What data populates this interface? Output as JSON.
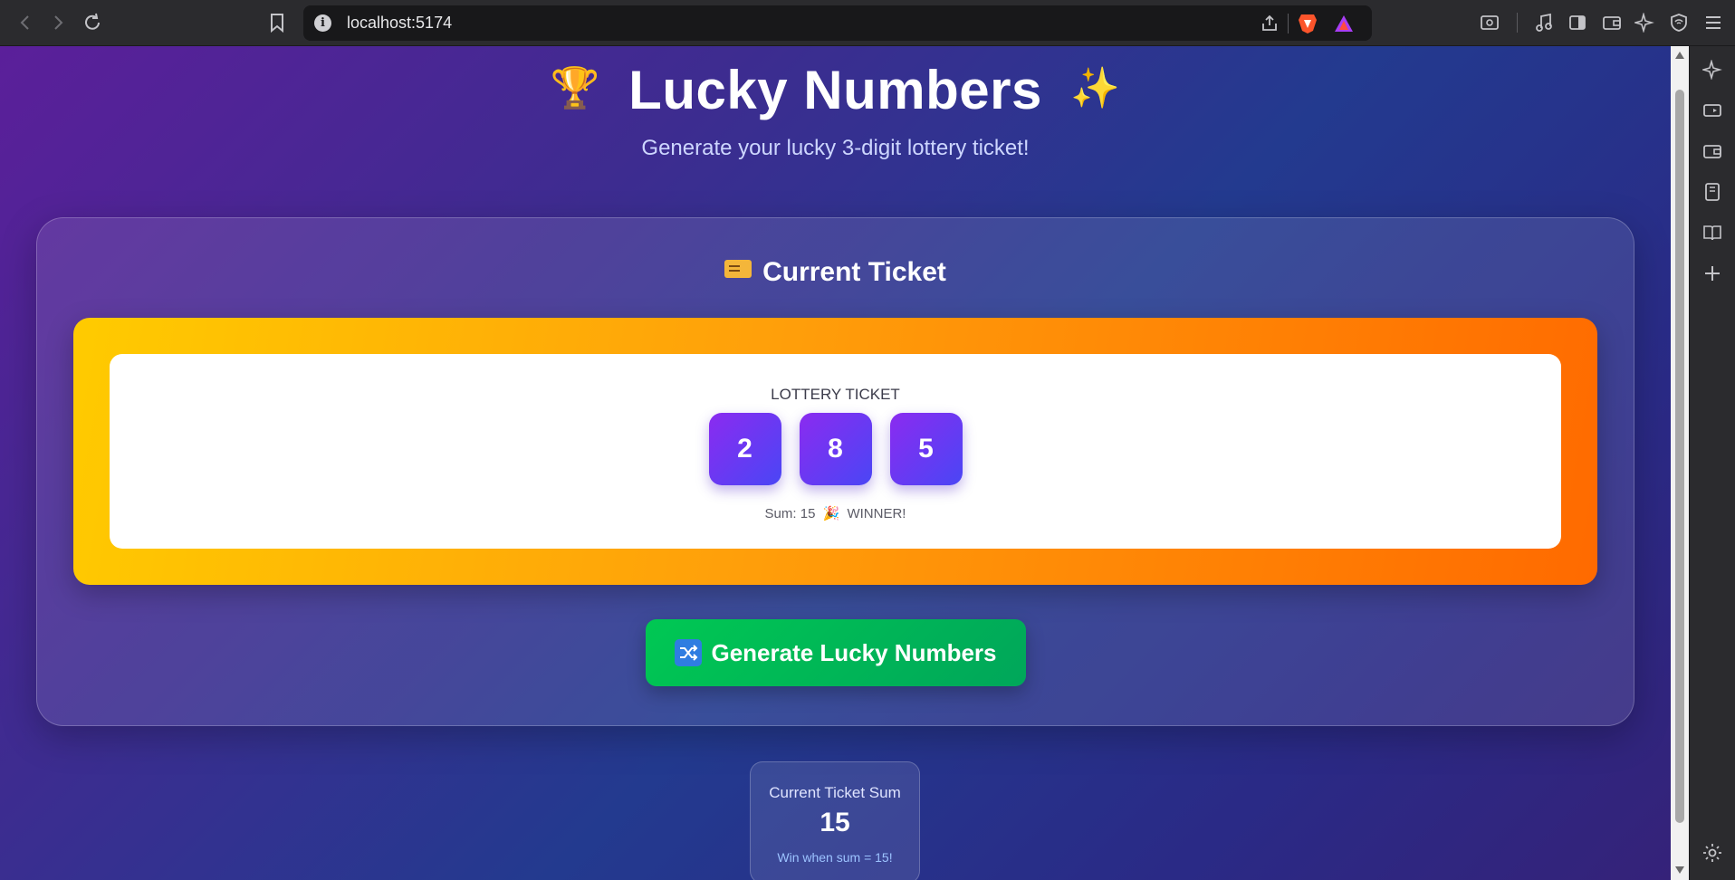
{
  "browser": {
    "url": "localhost:5174",
    "nav_icons": [
      "back-arrow-icon",
      "forward-arrow-icon",
      "reload-icon",
      "bookmark-icon"
    ],
    "toolbar_icons": [
      "page-search-icon",
      "music-icon",
      "sidebar-icon",
      "wallet-icon",
      "leo-ai-icon",
      "vpn-shield-icon",
      "menu-icon"
    ],
    "sidebar_icons": [
      "leo-ai-icon",
      "video-icon",
      "wallet-icon",
      "reading-list-icon",
      "book-icon",
      "add-icon",
      "settings-icon"
    ]
  },
  "page": {
    "title": "Lucky Numbers",
    "title_left_emoji": "🏆",
    "title_right_emoji": "✨",
    "subtitle": "Generate your lucky 3-digit lottery ticket!"
  },
  "ticket_card": {
    "heading": "Current Ticket",
    "ticket_label": "LOTTERY TICKET",
    "digits": [
      "2",
      "8",
      "5"
    ],
    "sum_text": "Sum: 15",
    "status_emoji": "🎉",
    "status_text": "WINNER!"
  },
  "generate_button": {
    "label": "Generate Lucky Numbers",
    "icon": "shuffle-icon"
  },
  "stat": {
    "label": "Current Ticket Sum",
    "value": "15",
    "note": "Win when sum = 15!"
  },
  "colors": {
    "ticket_gradient_start": "#ffcb00",
    "ticket_gradient_end": "#ff6a00",
    "digit_gradient_start": "#8b2bf0",
    "digit_gradient_end": "#4a46f5",
    "button_green": "#00c853"
  }
}
